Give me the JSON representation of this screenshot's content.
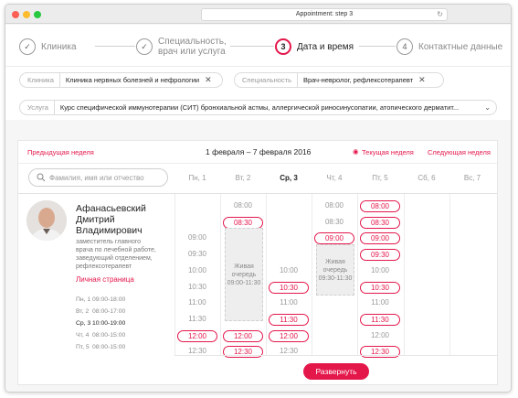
{
  "window": {
    "url": "Appointment: step 3",
    "reload_icon": "reload-icon"
  },
  "steps": [
    {
      "num": "✓",
      "label": "Клиника"
    },
    {
      "num": "✓",
      "label1": "Специальность,",
      "label2": "врач или услуга"
    },
    {
      "num": "3",
      "label": "Дата и время"
    },
    {
      "num": "4",
      "label": "Контактные данные"
    }
  ],
  "filters": {
    "clinic": {
      "label": "Клиника",
      "value": "Клиника нервных болезней и нефрологии"
    },
    "specialty": {
      "label": "Специальность",
      "value": "Врач-невролог, рефлексотерапевт"
    },
    "service": {
      "label": "Услуга",
      "value": "Курс специфической иммунотерапии (СИТ) бронхиальной астмы, аллергической риносинусопатии, атопического дерматит..."
    }
  },
  "week": {
    "prev": "Предыдущая неделя",
    "range": "1 февраля – 7 февраля 2016",
    "current": "Текущая неделя",
    "next": "Следующая неделя"
  },
  "search": {
    "placeholder": "Фамилия, имя или отчество"
  },
  "days": [
    "Пн, 1",
    "Вт, 2",
    "Ср, 3",
    "Чт, 4",
    "Пт, 5",
    "Сб, 6",
    "Вс, 7"
  ],
  "doctor": {
    "name1": "Афанасьевский",
    "name2": "Дмитрий",
    "name3": "Владимирович",
    "pos1": "заместитель главного",
    "pos2": "врача по лечебной работе,",
    "pos3": "заведующий отделением,",
    "pos4": "рефлексотерапевт",
    "link": "Личная страница",
    "schedule": [
      {
        "day": "Пн, 1",
        "hours": "09:00-18:00"
      },
      {
        "day": "Вт, 2",
        "hours": "08:00-17:00"
      },
      {
        "day": "Ср, 3",
        "hours": "10:00-19:00"
      },
      {
        "day": "Чт, 4",
        "hours": "08:00-15:00"
      },
      {
        "day": "Пт, 5",
        "hours": "08:00-15:00"
      }
    ]
  },
  "slots": {
    "mon": [
      {
        "t": "09:00",
        "s": 0
      },
      {
        "t": "09:30",
        "s": 0
      },
      {
        "t": "10:00",
        "s": 0
      },
      {
        "t": "10:30",
        "s": 0
      },
      {
        "t": "11:00",
        "s": 0
      },
      {
        "t": "11:30",
        "s": 0
      },
      {
        "t": "12:00",
        "s": 1
      },
      {
        "t": "12:30",
        "s": 0
      }
    ],
    "tue": [
      {
        "t": "08:00",
        "s": 0
      },
      {
        "t": "08:30",
        "s": 1
      },
      {
        "t": "12:00",
        "s": 1
      },
      {
        "t": "12:30",
        "s": 1
      }
    ],
    "tue_queue": "Живая очередь 09:00-11:30",
    "wed": [
      {
        "t": "10:00",
        "s": 0
      },
      {
        "t": "10:30",
        "s": 1
      },
      {
        "t": "11:00",
        "s": 0
      },
      {
        "t": "11:30",
        "s": 1
      },
      {
        "t": "12:00",
        "s": 1
      },
      {
        "t": "12:30",
        "s": 0
      }
    ],
    "thu": [
      {
        "t": "08:00",
        "s": 0
      },
      {
        "t": "08:30",
        "s": 0
      },
      {
        "t": "09:00",
        "s": 1
      }
    ],
    "thu_queue": "Живая очередь 09:30-11:30",
    "fri": [
      {
        "t": "08:00",
        "s": 1
      },
      {
        "t": "08:30",
        "s": 1
      },
      {
        "t": "09:00",
        "s": 1
      },
      {
        "t": "09:30",
        "s": 1
      },
      {
        "t": "10:00",
        "s": 0
      },
      {
        "t": "10:30",
        "s": 1
      },
      {
        "t": "11:00",
        "s": 0
      },
      {
        "t": "11:30",
        "s": 1
      },
      {
        "t": "12:00",
        "s": 0
      },
      {
        "t": "12:30",
        "s": 1
      }
    ]
  },
  "expand_label": "Развернуть",
  "colors": {
    "accent": "#e4174b"
  }
}
